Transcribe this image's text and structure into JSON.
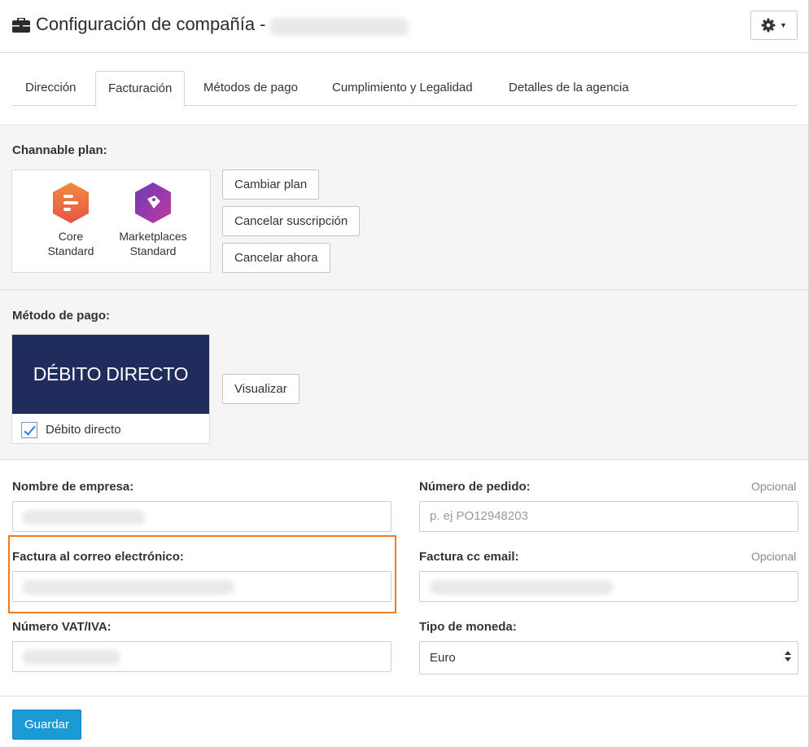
{
  "header": {
    "title": "Configuración de compañía -",
    "icon": "briefcase-icon",
    "settings_icon": "gear-icon"
  },
  "tabs": [
    {
      "label": "Dirección"
    },
    {
      "label": "Facturación",
      "active": true
    },
    {
      "label": "Métodos de pago"
    },
    {
      "label": "Cumplimiento y Legalidad"
    },
    {
      "label": "Detalles de la agencia"
    }
  ],
  "plan_section": {
    "label": "Channable plan:",
    "plans": [
      {
        "line1": "Core",
        "line2": "Standard",
        "icon": "core-plan-icon",
        "color": "#ee6a3b"
      },
      {
        "line1": "Marketplaces",
        "line2": "Standard",
        "icon": "marketplaces-plan-icon",
        "color": "#8e3bb3"
      }
    ],
    "buttons": {
      "change": "Cambiar plan",
      "cancel_subscription": "Cancelar suscripción",
      "cancel_now": "Cancelar ahora"
    }
  },
  "payment_section": {
    "label": "Método de pago:",
    "banner": "DÉBITO DIRECTO",
    "checkbox_label": "Débito directo",
    "checked": true,
    "view_button": "Visualizar"
  },
  "form": {
    "company_name": {
      "label": "Nombre de empresa:"
    },
    "order_number": {
      "label": "Número de pedido:",
      "optional": "Opcional",
      "placeholder": "p. ej PO12948203"
    },
    "invoice_email": {
      "label": "Factura al correo electrónico:"
    },
    "invoice_cc": {
      "label": "Factura cc email:",
      "optional": "Opcional"
    },
    "vat": {
      "label": "Número VAT/IVA:"
    },
    "currency": {
      "label": "Tipo de moneda:",
      "value": "Euro"
    },
    "save": "Guardar"
  },
  "colors": {
    "accent": "#1a9bd7",
    "banner": "#1f2c5c",
    "highlight": "#f07a22"
  }
}
